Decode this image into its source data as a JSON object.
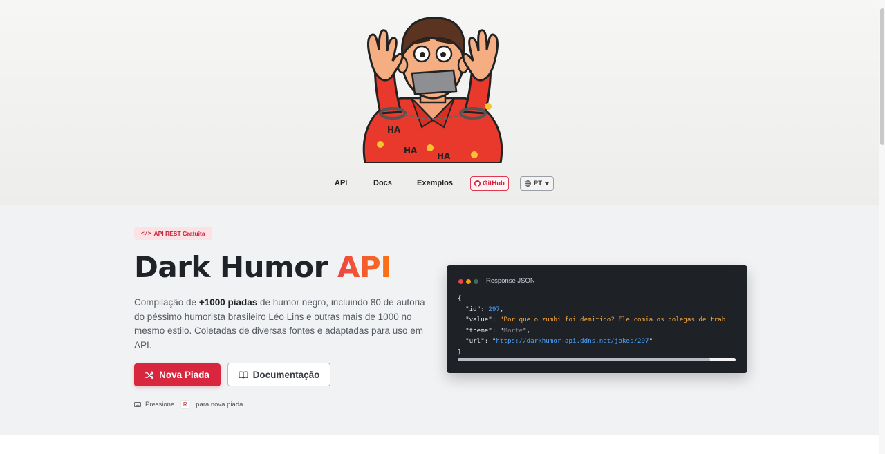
{
  "nav": {
    "api": "API",
    "docs": "Docs",
    "examples": "Exemplos",
    "github": "GitHub",
    "lang": "PT"
  },
  "mascot": {
    "tag": "HA"
  },
  "hero": {
    "badge": "API REST Gratuita",
    "title_main": "Dark Humor",
    "title_accent": "API",
    "desc_1": "Compilação de ",
    "desc_bold": "+1000 piadas",
    "desc_2": " de humor negro, incluindo 80 de autoria do péssimo humorista brasileiro Léo Lins e outras mais de 1000 no mesmo estilo. Coletadas de diversas fontes e adaptadas para uso em API.",
    "primary_btn": "Nova Piada",
    "secondary_btn": "Documentação",
    "hint_before": "Pressione",
    "hint_key": "R",
    "hint_after": "para nova piada"
  },
  "code_card": {
    "title": "Response JSON",
    "open_brace": "{",
    "close_brace": "}",
    "id_key": "\"id\"",
    "id_value": "297",
    "value_key": "\"value\"",
    "value_value": "\"Por que o zumbi foi demitido? Ele comia os colegas de trab",
    "theme_key": "\"theme\"",
    "theme_value": "Morte",
    "url_key": "\"url\"",
    "url_value": "https://darkhumor-api.ddns.net/jokes/297",
    "scroll_position": 0.91
  },
  "colors": {
    "accent": "#d7263d",
    "code_bg": "#1e2227",
    "dot_red": "#ef4444",
    "dot_yellow": "#f59e0b",
    "dot_green": "#3b6e5e"
  }
}
